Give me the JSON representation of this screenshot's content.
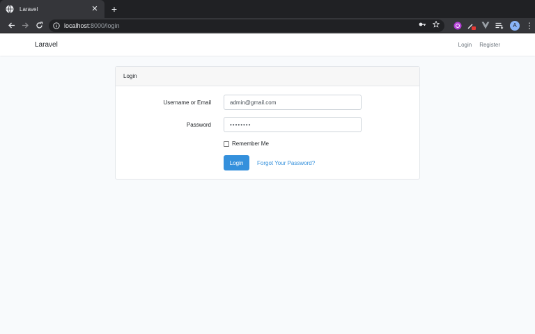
{
  "browser": {
    "tab_title": "Laravel",
    "tab_close": "✕",
    "new_tab": "+",
    "url_host": "localhost",
    "url_path": ":8000/login",
    "avatar_letter": "A"
  },
  "navbar": {
    "brand": "Laravel",
    "links": [
      "Login",
      "Register"
    ]
  },
  "card": {
    "header": "Login",
    "username_label": "Username or Email",
    "username_value": "admin@gmail.com",
    "password_label": "Password",
    "password_value": "••••••••",
    "remember_label": "Remember Me",
    "remember_checked": false,
    "login_button": "Login",
    "forgot_link": "Forgot Your Password?"
  },
  "colors": {
    "accent": "#3490dc",
    "page_bg": "#f8fafc",
    "chrome_dark": "#202124",
    "chrome_toolbar": "#35363a"
  }
}
